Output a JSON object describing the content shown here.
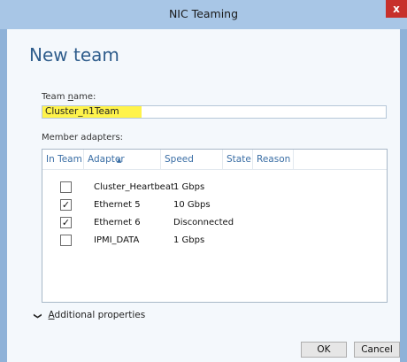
{
  "window": {
    "title": "NIC Teaming",
    "close_glyph": "x"
  },
  "heading": "New team",
  "team_name": {
    "label_pre": "Team ",
    "label_mnemonic": "n",
    "label_post": "ame:",
    "value": "Cluster_n1Team"
  },
  "member_adapters": {
    "label": "Member adapters:",
    "columns": [
      "In Team",
      "Adapter",
      "Speed",
      "State",
      "Reason"
    ],
    "rows": [
      {
        "in_team": false,
        "check": "",
        "adapter": "Cluster_Heartbeat",
        "speed": "1 Gbps",
        "state": "",
        "reason": ""
      },
      {
        "in_team": true,
        "check": "✓",
        "adapter": "Ethernet 5",
        "speed": "10 Gbps",
        "state": "",
        "reason": ""
      },
      {
        "in_team": true,
        "check": "✓",
        "adapter": "Ethernet 6",
        "speed": "Disconnected",
        "state": "",
        "reason": ""
      },
      {
        "in_team": false,
        "check": "",
        "adapter": "IPMI_DATA",
        "speed": "1 Gbps",
        "state": "",
        "reason": ""
      }
    ]
  },
  "additional_properties": {
    "mnemonic": "A",
    "rest": "dditional properties"
  },
  "buttons": {
    "ok": "OK",
    "cancel": "Cancel"
  },
  "colors": {
    "accent": "#2f5d8c",
    "titlebar": "#a8c6e6",
    "highlight": "#fff34a",
    "close": "#c7302b"
  }
}
